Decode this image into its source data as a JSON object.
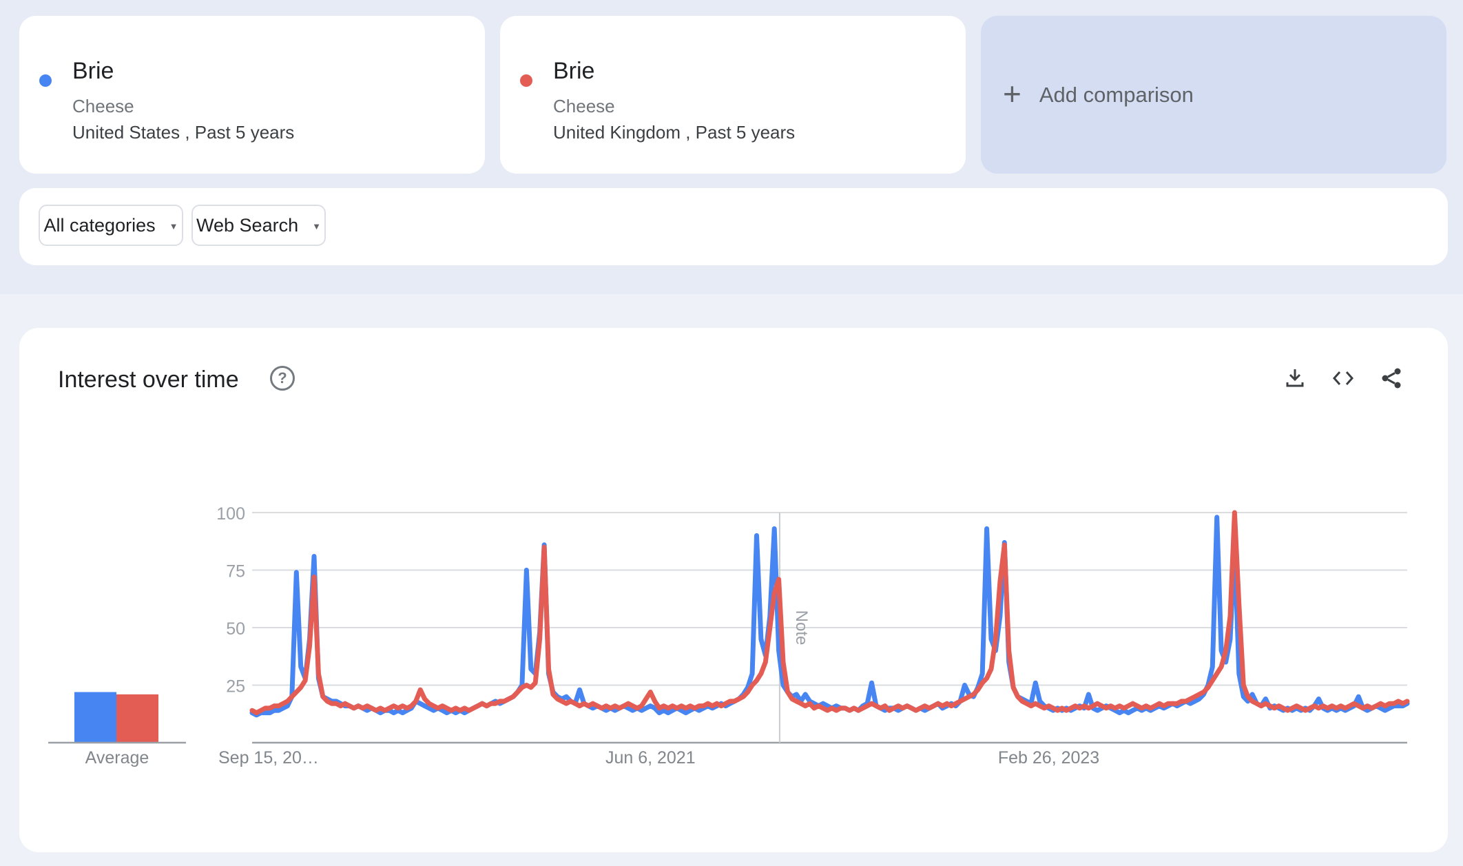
{
  "page": {
    "background_top": "#e7ebf6",
    "background_bottom": "#eef1f8"
  },
  "terms": [
    {
      "keyword": "Brie",
      "type": "Cheese",
      "scope": "United States , Past 5 years",
      "color": "#4785f3"
    },
    {
      "keyword": "Brie",
      "type": "Cheese",
      "scope": "United Kingdom , Past 5 years",
      "color": "#e35d55"
    }
  ],
  "add_comparison": {
    "plus_icon": "+",
    "label": "Add comparison"
  },
  "filters": {
    "category": "All categories",
    "search_type": "Web Search",
    "caret_icon": "▼"
  },
  "section": {
    "title": "Interest over time",
    "help_glyph": "?"
  },
  "chart_data": {
    "type": "line",
    "title": "Interest over time",
    "x_unit": "weekly points, Past 5 years",
    "x_ticks": [
      {
        "label": "Sep 15, 20…",
        "week": 0,
        "align": "left"
      },
      {
        "label": "Jun 6, 2021",
        "week": 90,
        "align": "center"
      },
      {
        "label": "Feb 26, 2023",
        "week": 180,
        "align": "center"
      }
    ],
    "y_ticks": [
      25,
      50,
      75,
      100
    ],
    "ylim": [
      0,
      100
    ],
    "grid": true,
    "legend_position": "none",
    "note": {
      "label": "Note",
      "week": 119.2
    },
    "average": {
      "label": "Average",
      "values": [
        22,
        21
      ]
    },
    "series": [
      {
        "name": "Brie · United States",
        "color": "#4785f3",
        "values": [
          13,
          12,
          13,
          13,
          13,
          14,
          14,
          15,
          16,
          20,
          74,
          33,
          28,
          45,
          81,
          28,
          20,
          19,
          18,
          18,
          17,
          16,
          16,
          15,
          16,
          15,
          14,
          15,
          14,
          13,
          14,
          14,
          13,
          14,
          13,
          14,
          15,
          18,
          17,
          16,
          15,
          14,
          15,
          14,
          13,
          14,
          13,
          14,
          13,
          14,
          15,
          16,
          17,
          16,
          17,
          18,
          17,
          18,
          19,
          20,
          22,
          25,
          75,
          32,
          30,
          48,
          86,
          30,
          22,
          20,
          19,
          20,
          18,
          17,
          23,
          17,
          16,
          15,
          16,
          15,
          14,
          15,
          14,
          15,
          16,
          15,
          14,
          15,
          14,
          15,
          16,
          15,
          13,
          14,
          13,
          14,
          15,
          14,
          13,
          14,
          15,
          14,
          15,
          16,
          15,
          16,
          17,
          16,
          17,
          18,
          19,
          21,
          24,
          30,
          90,
          45,
          38,
          55,
          93,
          40,
          25,
          22,
          20,
          21,
          18,
          21,
          18,
          17,
          16,
          17,
          16,
          15,
          16,
          15,
          15,
          14,
          15,
          14,
          16,
          17,
          26,
          16,
          15,
          14,
          15,
          15,
          14,
          15,
          16,
          15,
          14,
          15,
          14,
          15,
          16,
          17,
          15,
          16,
          17,
          16,
          18,
          25,
          21,
          20,
          24,
          30,
          93,
          45,
          40,
          55,
          87,
          35,
          24,
          20,
          19,
          18,
          17,
          26,
          18,
          16,
          15,
          14,
          15,
          14,
          15,
          14,
          15,
          16,
          15,
          21,
          15,
          14,
          15,
          16,
          15,
          14,
          13,
          14,
          13,
          14,
          15,
          14,
          15,
          14,
          15,
          16,
          15,
          16,
          17,
          16,
          17,
          18,
          17,
          18,
          19,
          21,
          25,
          33,
          98,
          40,
          35,
          45,
          86,
          30,
          20,
          18,
          21,
          17,
          16,
          19,
          15,
          16,
          15,
          14,
          15,
          14,
          15,
          14,
          15,
          14,
          16,
          19,
          15,
          14,
          15,
          14,
          15,
          14,
          15,
          16,
          20,
          15,
          14,
          15,
          16,
          15,
          14,
          15,
          16,
          16,
          16,
          17
        ]
      },
      {
        "name": "Brie · United Kingdom",
        "color": "#e35d55",
        "values": [
          14,
          13,
          14,
          15,
          15,
          16,
          16,
          17,
          18,
          20,
          22,
          24,
          27,
          42,
          72,
          30,
          20,
          18,
          17,
          17,
          16,
          17,
          16,
          15,
          16,
          15,
          16,
          15,
          14,
          15,
          14,
          15,
          16,
          15,
          16,
          15,
          16,
          18,
          23,
          19,
          17,
          16,
          15,
          16,
          15,
          14,
          15,
          14,
          15,
          14,
          15,
          16,
          17,
          16,
          17,
          17,
          18,
          18,
          19,
          20,
          22,
          24,
          25,
          24,
          26,
          45,
          85,
          32,
          21,
          19,
          18,
          17,
          18,
          17,
          16,
          17,
          16,
          17,
          16,
          15,
          16,
          15,
          16,
          15,
          16,
          17,
          16,
          15,
          16,
          19,
          22,
          18,
          15,
          16,
          15,
          16,
          15,
          16,
          15,
          16,
          15,
          16,
          16,
          17,
          16,
          17,
          16,
          17,
          18,
          18,
          19,
          20,
          22,
          25,
          27,
          30,
          35,
          50,
          65,
          71,
          35,
          22,
          19,
          18,
          17,
          16,
          17,
          15,
          16,
          15,
          14,
          15,
          14,
          15,
          15,
          14,
          15,
          14,
          15,
          16,
          17,
          16,
          15,
          16,
          14,
          15,
          16,
          15,
          16,
          15,
          14,
          15,
          16,
          15,
          16,
          17,
          16,
          17,
          16,
          17,
          18,
          19,
          20,
          21,
          23,
          26,
          28,
          32,
          45,
          70,
          86,
          40,
          24,
          20,
          18,
          17,
          16,
          17,
          16,
          15,
          16,
          15,
          14,
          15,
          14,
          15,
          16,
          15,
          16,
          15,
          16,
          17,
          16,
          15,
          16,
          15,
          16,
          15,
          16,
          17,
          16,
          15,
          16,
          15,
          16,
          17,
          16,
          17,
          17,
          17,
          18,
          18,
          19,
          20,
          21,
          22,
          24,
          27,
          30,
          33,
          40,
          55,
          100,
          60,
          25,
          20,
          18,
          17,
          16,
          17,
          16,
          15,
          16,
          15,
          14,
          15,
          16,
          15,
          14,
          15,
          16,
          15,
          16,
          15,
          16,
          15,
          16,
          15,
          16,
          17,
          16,
          15,
          16,
          15,
          16,
          17,
          16,
          17,
          17,
          18,
          17,
          18
        ]
      }
    ]
  }
}
